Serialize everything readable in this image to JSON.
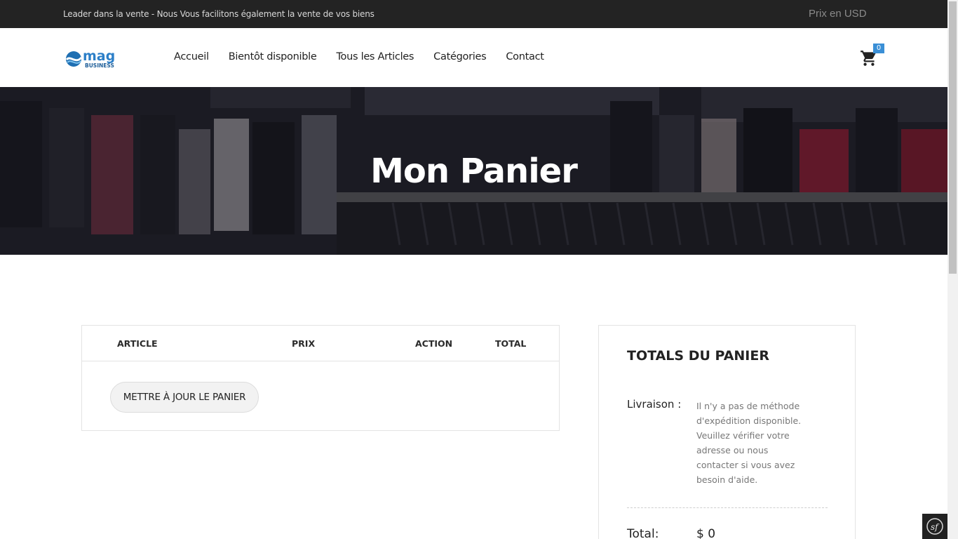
{
  "topbar": {
    "tagline": "Leader dans la vente - Nous Vous facilitons également la vente de vos biens",
    "currency": "Prix en USD"
  },
  "logo": {
    "text": "mag",
    "subtext": "BUSINESS"
  },
  "nav": {
    "items": [
      {
        "label": "Accueil"
      },
      {
        "label": "Bientôt disponible"
      },
      {
        "label": "Tous les Articles"
      },
      {
        "label": "Catégories"
      },
      {
        "label": "Contact"
      }
    ]
  },
  "cart": {
    "count": "0",
    "icon": "shopping-cart-icon"
  },
  "hero": {
    "title": "Mon Panier"
  },
  "cart_table": {
    "headers": [
      "ARTICLE",
      "PRIX",
      "ACTION",
      "TOTAL"
    ],
    "update_button": "METTRE À JOUR LE PANIER"
  },
  "totals": {
    "title": "TOTALS DU PANIER",
    "shipping_label": "Livraison :",
    "shipping_message": "Il n'y a pas de méthode d'expédition disponible. Veuillez vérifier votre adresse ou nous contacter si vous avez besoin d'aide.",
    "total_label": "Total:",
    "total_value": "$ 0"
  },
  "colors": {
    "topbar_bg": "#232323",
    "accent": "#3a8fd6",
    "hero_text": "#ffffff"
  },
  "debug": {
    "icon": "symfony-icon",
    "label": "sf"
  }
}
